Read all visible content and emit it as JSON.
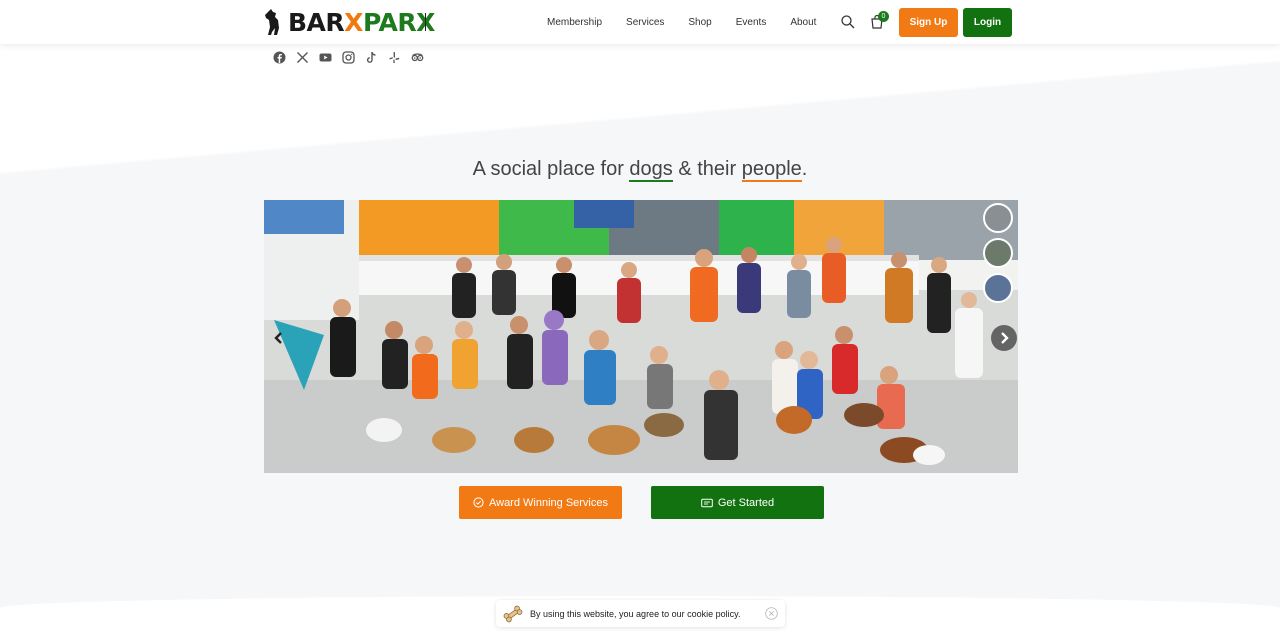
{
  "brand": {
    "part1": "BAR",
    "part2": "X",
    "part3": "PARX",
    "colors": {
      "orange": "#f27a14",
      "green": "#12720f",
      "dark": "#1a1a1a"
    }
  },
  "nav": {
    "items": [
      "Membership",
      "Services",
      "Shop",
      "Events",
      "About"
    ],
    "cart_count": "0",
    "signup_label": "Sign Up",
    "login_label": "Login"
  },
  "social": [
    "facebook-icon",
    "x-icon",
    "youtube-icon",
    "instagram-icon",
    "tiktok-icon",
    "yelp-icon",
    "tripadvisor-icon"
  ],
  "hero": {
    "headline_pre": "A social place for ",
    "headline_word1": "dogs",
    "headline_mid": " & their ",
    "headline_word2": "people",
    "headline_post": "."
  },
  "cta": {
    "award_label": "Award Winning Services",
    "start_label": "Get Started"
  },
  "cookie": {
    "text_pre": "By using this website, you agree to our ",
    "text_link": "cookie policy",
    "text_post": "."
  }
}
